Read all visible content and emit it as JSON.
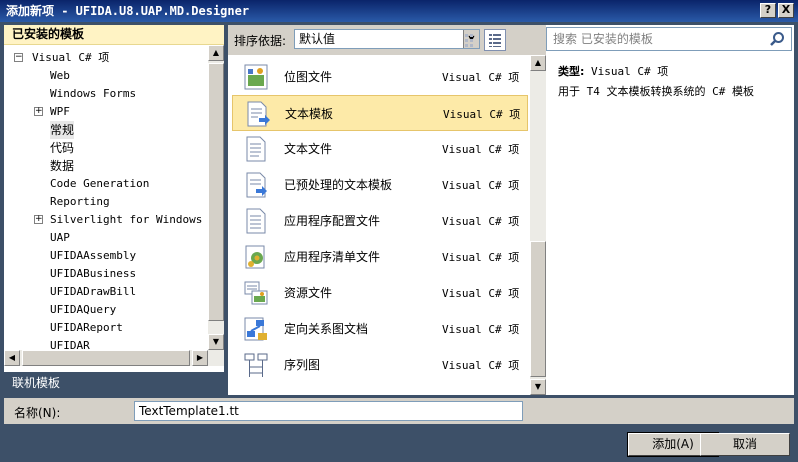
{
  "window": {
    "title": "添加新项 - UFIDA.U8.UAP.MD.Designer",
    "help_label": "?",
    "close_label": "X"
  },
  "left": {
    "installed_header": "已安装的模板",
    "online_header": "联机模板",
    "tree": [
      {
        "label": "Visual C# 项",
        "level": 0,
        "expander": "−"
      },
      {
        "label": "Web",
        "level": 1,
        "expander": ""
      },
      {
        "label": "Windows Forms",
        "level": 1,
        "expander": ""
      },
      {
        "label": "WPF",
        "level": 1,
        "expander": "+"
      },
      {
        "label": "常规",
        "level": 1,
        "expander": "",
        "selected": true
      },
      {
        "label": "代码",
        "level": 1,
        "expander": ""
      },
      {
        "label": "数据",
        "level": 1,
        "expander": ""
      },
      {
        "label": "Code Generation",
        "level": 1,
        "expander": ""
      },
      {
        "label": "Reporting",
        "level": 1,
        "expander": ""
      },
      {
        "label": "Silverlight for Windows Ph",
        "level": 1,
        "expander": "+"
      },
      {
        "label": "UAP",
        "level": 1,
        "expander": ""
      },
      {
        "label": "UFIDAAssembly",
        "level": 1,
        "expander": ""
      },
      {
        "label": "UFIDABusiness",
        "level": 1,
        "expander": ""
      },
      {
        "label": "UFIDADrawBill",
        "level": 1,
        "expander": ""
      },
      {
        "label": "UFIDAQuery",
        "level": 1,
        "expander": ""
      },
      {
        "label": "UFIDAReport",
        "level": 1,
        "expander": ""
      },
      {
        "label": "UFIDAR",
        "level": 1,
        "expander": ""
      }
    ]
  },
  "sort": {
    "label": "排序依据:",
    "value": "默认值"
  },
  "templates": [
    {
      "name": "位图文件",
      "lang": "Visual C# 项",
      "icon": "bitmap-file-icon"
    },
    {
      "name": "文本模板",
      "lang": "Visual C# 项",
      "icon": "text-template-icon",
      "selected": true
    },
    {
      "name": "文本文件",
      "lang": "Visual C# 项",
      "icon": "text-file-icon"
    },
    {
      "name": "已预处理的文本模板",
      "lang": "Visual C# 项",
      "icon": "preprocessed-template-icon"
    },
    {
      "name": "应用程序配置文件",
      "lang": "Visual C# 项",
      "icon": "config-file-icon"
    },
    {
      "name": "应用程序清单文件",
      "lang": "Visual C# 项",
      "icon": "manifest-file-icon"
    },
    {
      "name": "资源文件",
      "lang": "Visual C# 项",
      "icon": "resource-file-icon"
    },
    {
      "name": "定向关系图文档",
      "lang": "Visual C# 项",
      "icon": "dgml-document-icon"
    },
    {
      "name": "序列图",
      "lang": "Visual C# 项",
      "icon": "sequence-diagram-icon"
    }
  ],
  "search": {
    "placeholder": "搜索 已安装的模板"
  },
  "details": {
    "type_label": "类型:",
    "type_value": "Visual C# 项",
    "description": "用于 T4 文本模板转换系统的 C# 模板"
  },
  "name": {
    "label": "名称(N):",
    "value": "TextTemplate1.tt"
  },
  "buttons": {
    "add": "添加(A)",
    "cancel": "取消"
  }
}
